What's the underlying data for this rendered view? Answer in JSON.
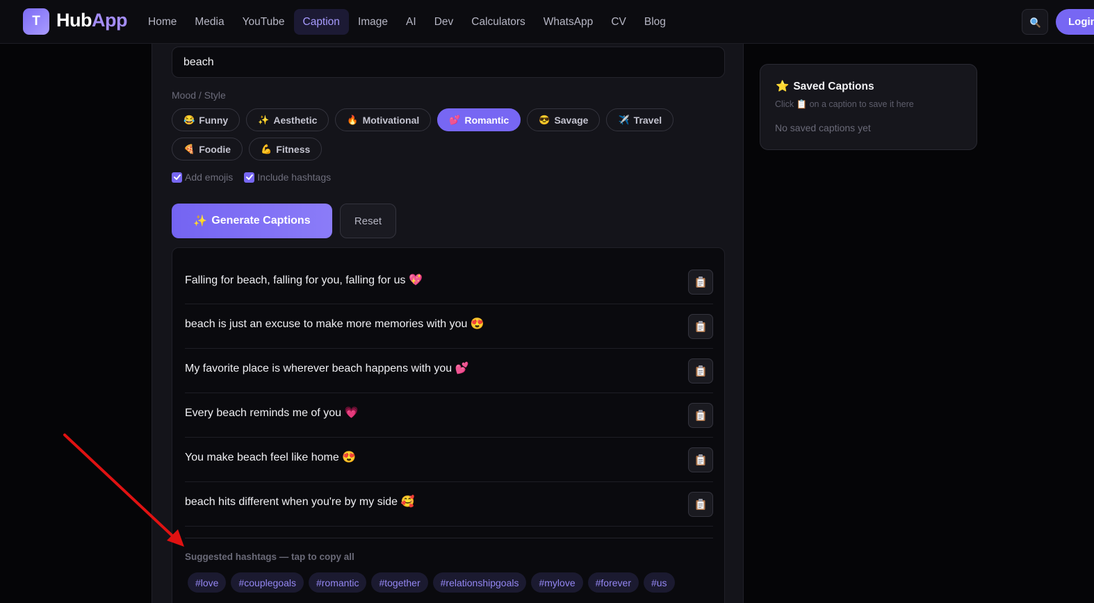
{
  "brand": {
    "logo_letter": "T",
    "name_part1": "Hub",
    "name_part2": "App"
  },
  "nav": [
    {
      "label": "Home"
    },
    {
      "label": "Media"
    },
    {
      "label": "YouTube"
    },
    {
      "label": "Caption",
      "active": true
    },
    {
      "label": "Image"
    },
    {
      "label": "AI"
    },
    {
      "label": "Dev"
    },
    {
      "label": "Calculators"
    },
    {
      "label": "WhatsApp"
    },
    {
      "label": "CV"
    },
    {
      "label": "Blog"
    }
  ],
  "header": {
    "login_label": "Login"
  },
  "form": {
    "topic_value": "beach",
    "mood_label": "Mood / Style",
    "moods": [
      {
        "emoji": "😂",
        "label": "Funny"
      },
      {
        "emoji": "✨",
        "label": "Aesthetic"
      },
      {
        "emoji": "🔥",
        "label": "Motivational"
      },
      {
        "emoji": "💕",
        "label": "Romantic",
        "active": true
      },
      {
        "emoji": "😎",
        "label": "Savage"
      },
      {
        "emoji": "✈️",
        "label": "Travel"
      },
      {
        "emoji": "🍕",
        "label": "Foodie"
      },
      {
        "emoji": "💪",
        "label": "Fitness"
      }
    ],
    "add_emojis_label": "Add emojis",
    "include_hashtags_label": "Include hashtags",
    "generate_emoji": "✨",
    "generate_label": "Generate Captions",
    "reset_label": "Reset"
  },
  "captions": [
    "Falling for beach, falling for you, falling for us 💖",
    "beach is just an excuse to make more memories with you 😍",
    "My favorite place is wherever beach happens with you 💕",
    "Every beach reminds me of you 💗",
    "You make beach feel like home 😍",
    "beach hits different when you're by my side 🥰"
  ],
  "hashtags": {
    "label": "Suggested hashtags — tap to copy all",
    "tags": [
      "#love",
      "#couplegoals",
      "#romantic",
      "#together",
      "#relationshipgoals",
      "#mylove",
      "#forever",
      "#us"
    ]
  },
  "saved": {
    "title_emoji": "⭐",
    "title": "Saved Captions",
    "hint": "Click 📋 on a caption to save it here",
    "empty": "No saved captions yet"
  },
  "colors": {
    "accent": "#7767f3",
    "annotation_arrow": "#e01212"
  }
}
